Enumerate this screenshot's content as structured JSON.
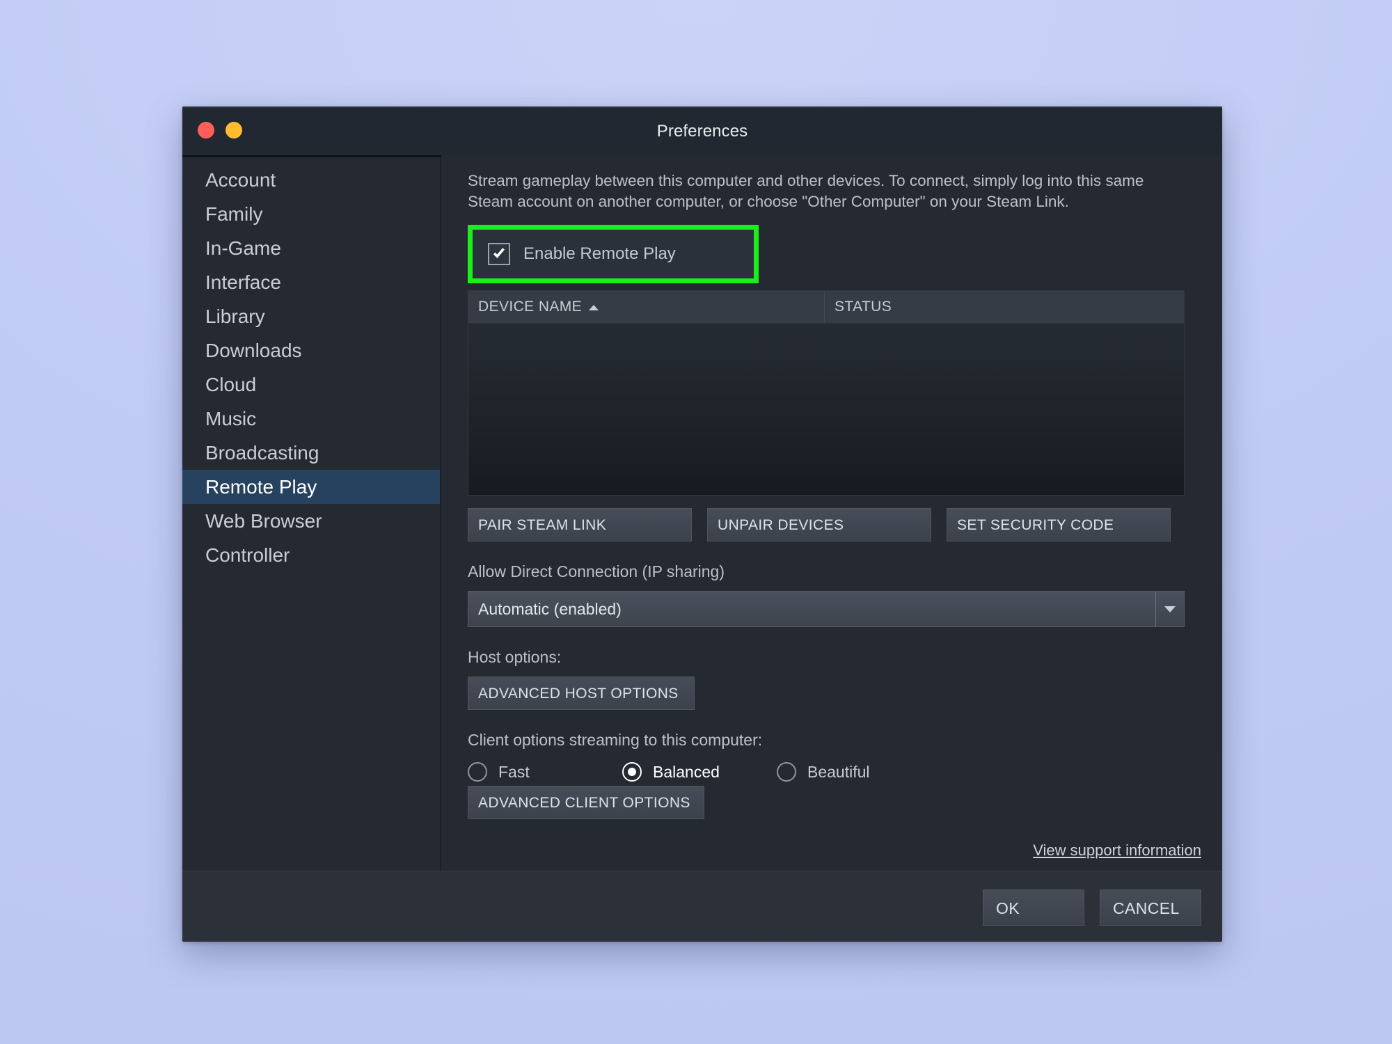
{
  "window": {
    "title": "Preferences",
    "traffic_lights": [
      "close",
      "minimize"
    ]
  },
  "sidebar": {
    "items": [
      {
        "label": "Account",
        "selected": false
      },
      {
        "label": "Family",
        "selected": false
      },
      {
        "label": "In-Game",
        "selected": false
      },
      {
        "label": "Interface",
        "selected": false
      },
      {
        "label": "Library",
        "selected": false
      },
      {
        "label": "Downloads",
        "selected": false
      },
      {
        "label": "Cloud",
        "selected": false
      },
      {
        "label": "Music",
        "selected": false
      },
      {
        "label": "Broadcasting",
        "selected": false
      },
      {
        "label": "Remote Play",
        "selected": true
      },
      {
        "label": "Web Browser",
        "selected": false
      },
      {
        "label": "Controller",
        "selected": false
      }
    ]
  },
  "main": {
    "description": "Stream gameplay between this computer and other devices. To connect, simply log into this same Steam account on another computer, or choose \"Other Computer\" on your Steam Link.",
    "enable_remote_play": {
      "label": "Enable Remote Play",
      "checked": true,
      "highlight_color": "#19ef19"
    },
    "device_table": {
      "columns": [
        "DEVICE NAME",
        "STATUS"
      ],
      "sort_column": "DEVICE NAME",
      "sort_direction": "ascending",
      "rows": []
    },
    "device_buttons": {
      "pair": "PAIR STEAM LINK",
      "unpair": "UNPAIR DEVICES",
      "security": "SET SECURITY CODE"
    },
    "direct_connection": {
      "label": "Allow Direct Connection (IP sharing)",
      "selected": "Automatic (enabled)"
    },
    "host_options": {
      "label": "Host options:",
      "button": "ADVANCED HOST OPTIONS"
    },
    "client_options": {
      "label": "Client options streaming to this computer:",
      "choices": [
        {
          "label": "Fast",
          "selected": false
        },
        {
          "label": "Balanced",
          "selected": true
        },
        {
          "label": "Beautiful",
          "selected": false
        }
      ],
      "button": "ADVANCED CLIENT OPTIONS"
    },
    "support_link": "View support information"
  },
  "footer": {
    "ok": "OK",
    "cancel": "CANCEL"
  },
  "colors": {
    "accent_selected": "#27425f",
    "highlight": "#19ef19",
    "window_bg": "#252a32",
    "desktop_bg": "#c3cdf5"
  }
}
